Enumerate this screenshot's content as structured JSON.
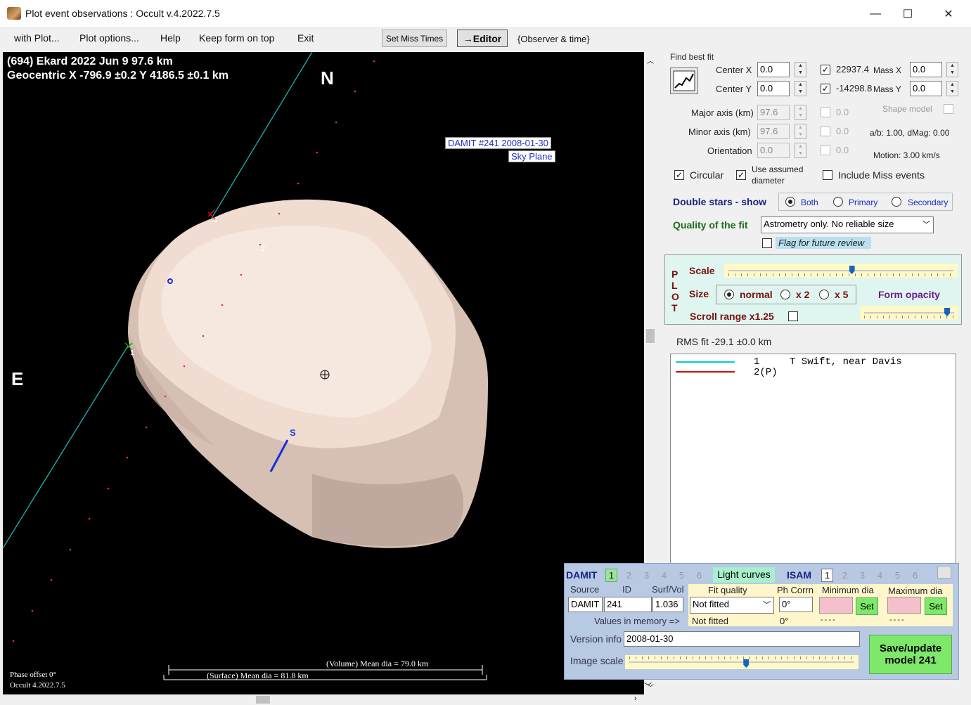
{
  "window": {
    "title": "Plot event observations : Occult v.4.2022.7.5",
    "minimize": "—",
    "maximize": "☐",
    "close": "✕"
  },
  "menu": {
    "with_plot": "with Plot...",
    "plot_options": "Plot options...",
    "help": "Help",
    "keep_on_top": "Keep form on top",
    "exit": "Exit",
    "set_miss_times": "Set Miss Times",
    "editor": "→Editor",
    "observer_time": "{Observer & time}"
  },
  "plot": {
    "line1": "(694) Ekard  2022 Jun 9   97.6 km",
    "line2": "Geocentric  X  -796.9 ±0.2  Y 4186.5 ±0.1 km",
    "north": "N",
    "east": "E",
    "south_pole": "S",
    "damit_label1": "DAMIT #241 2008-01-30",
    "damit_label2": "Sky Plane",
    "chord1": "1",
    "chord2": "2",
    "chord1b": "1",
    "volume_dia": "(Volume) Mean dia = 79.0 km",
    "surface_dia": "(Surface) Mean dia = 81.8 km",
    "phase_offset": "Phase offset 0°",
    "version": "Occult 4.2022.7.5"
  },
  "fit": {
    "find_best_fit": "Find best fit",
    "center_x_label": "Center X",
    "center_x": "0.0",
    "center_y_label": "Center Y",
    "center_y": "0.0",
    "mass_x_value": "22937.4",
    "mass_x_label": "Mass X",
    "mass_x": "0.0",
    "mass_y_value": "-14298.8",
    "mass_y_label": "Mass Y",
    "mass_y": "0.0",
    "major_axis_label": "Major axis (km)",
    "major_axis": "97.6",
    "minor_axis_label": "Minor axis (km)",
    "minor_axis": "97.6",
    "orientation_label": "Orientation",
    "orientation": "0.0",
    "zero1": "0.0",
    "zero2": "0.0",
    "zero3": "0.0",
    "shape_model": "Shape model",
    "ab_dmag": "a/b: 1.00, dMag: 0.00",
    "motion": "Motion: 3.00 km/s",
    "circular": "Circular",
    "use_assumed": "Use assumed",
    "diameter": "diameter",
    "include_miss": "Include Miss events",
    "double_stars": "Double stars - show",
    "both": "Both",
    "primary": "Primary",
    "secondary": "Secondary",
    "quality_label": "Quality of the fit",
    "quality_value": "Astrometry only. No reliable size",
    "flag_review": "Flag for future review"
  },
  "plotbox": {
    "plot_vertical": [
      "P",
      "L",
      "O",
      "T"
    ],
    "scale": "Scale",
    "size": "Size",
    "normal": "normal",
    "x2": "x 2",
    "x5": "x 5",
    "form_opacity": "Form opacity",
    "scroll_range": "Scroll range x1.25",
    "scale_level": 0.55,
    "opacity_level": 0.95
  },
  "rms": "RMS fit -29.1 ±0.0 km",
  "observers": [
    {
      "num": "1",
      "name": "T Swift, near Davis",
      "color": "#00d0d0"
    },
    {
      "num": "2(P)",
      "name": "",
      "color": "#d01010"
    }
  ],
  "damit": {
    "title": "DAMIT",
    "nums": [
      "1",
      "2",
      "3",
      "4",
      "5",
      "6"
    ],
    "light_curves": "Light curves",
    "isam": "ISAM",
    "isam_nums": [
      "1",
      "2",
      "3",
      "4",
      "5",
      "6"
    ],
    "source_label": "Source",
    "id_label": "ID",
    "surf_vol_label": "Surf/Vol",
    "fit_quality_label": "Fit quality",
    "ph_corr_label": "Ph Corrn",
    "min_dia_label": "Minimum dia",
    "max_dia_label": "Maximum dia",
    "source": "DAMIT",
    "id": "241",
    "surf_vol": "1.036",
    "fit_quality": "Not fitted",
    "ph_corr": "0°",
    "set": "Set",
    "values_in_memory": "Values in memory =>",
    "mem_fit": "Not fitted",
    "mem_ph": "0°",
    "dashes": "----",
    "version_label": "Version info",
    "version": "2008-01-30",
    "image_scale_label": "Image scale",
    "image_scale_level": 0.52,
    "save_button": "Save/update model 241"
  }
}
